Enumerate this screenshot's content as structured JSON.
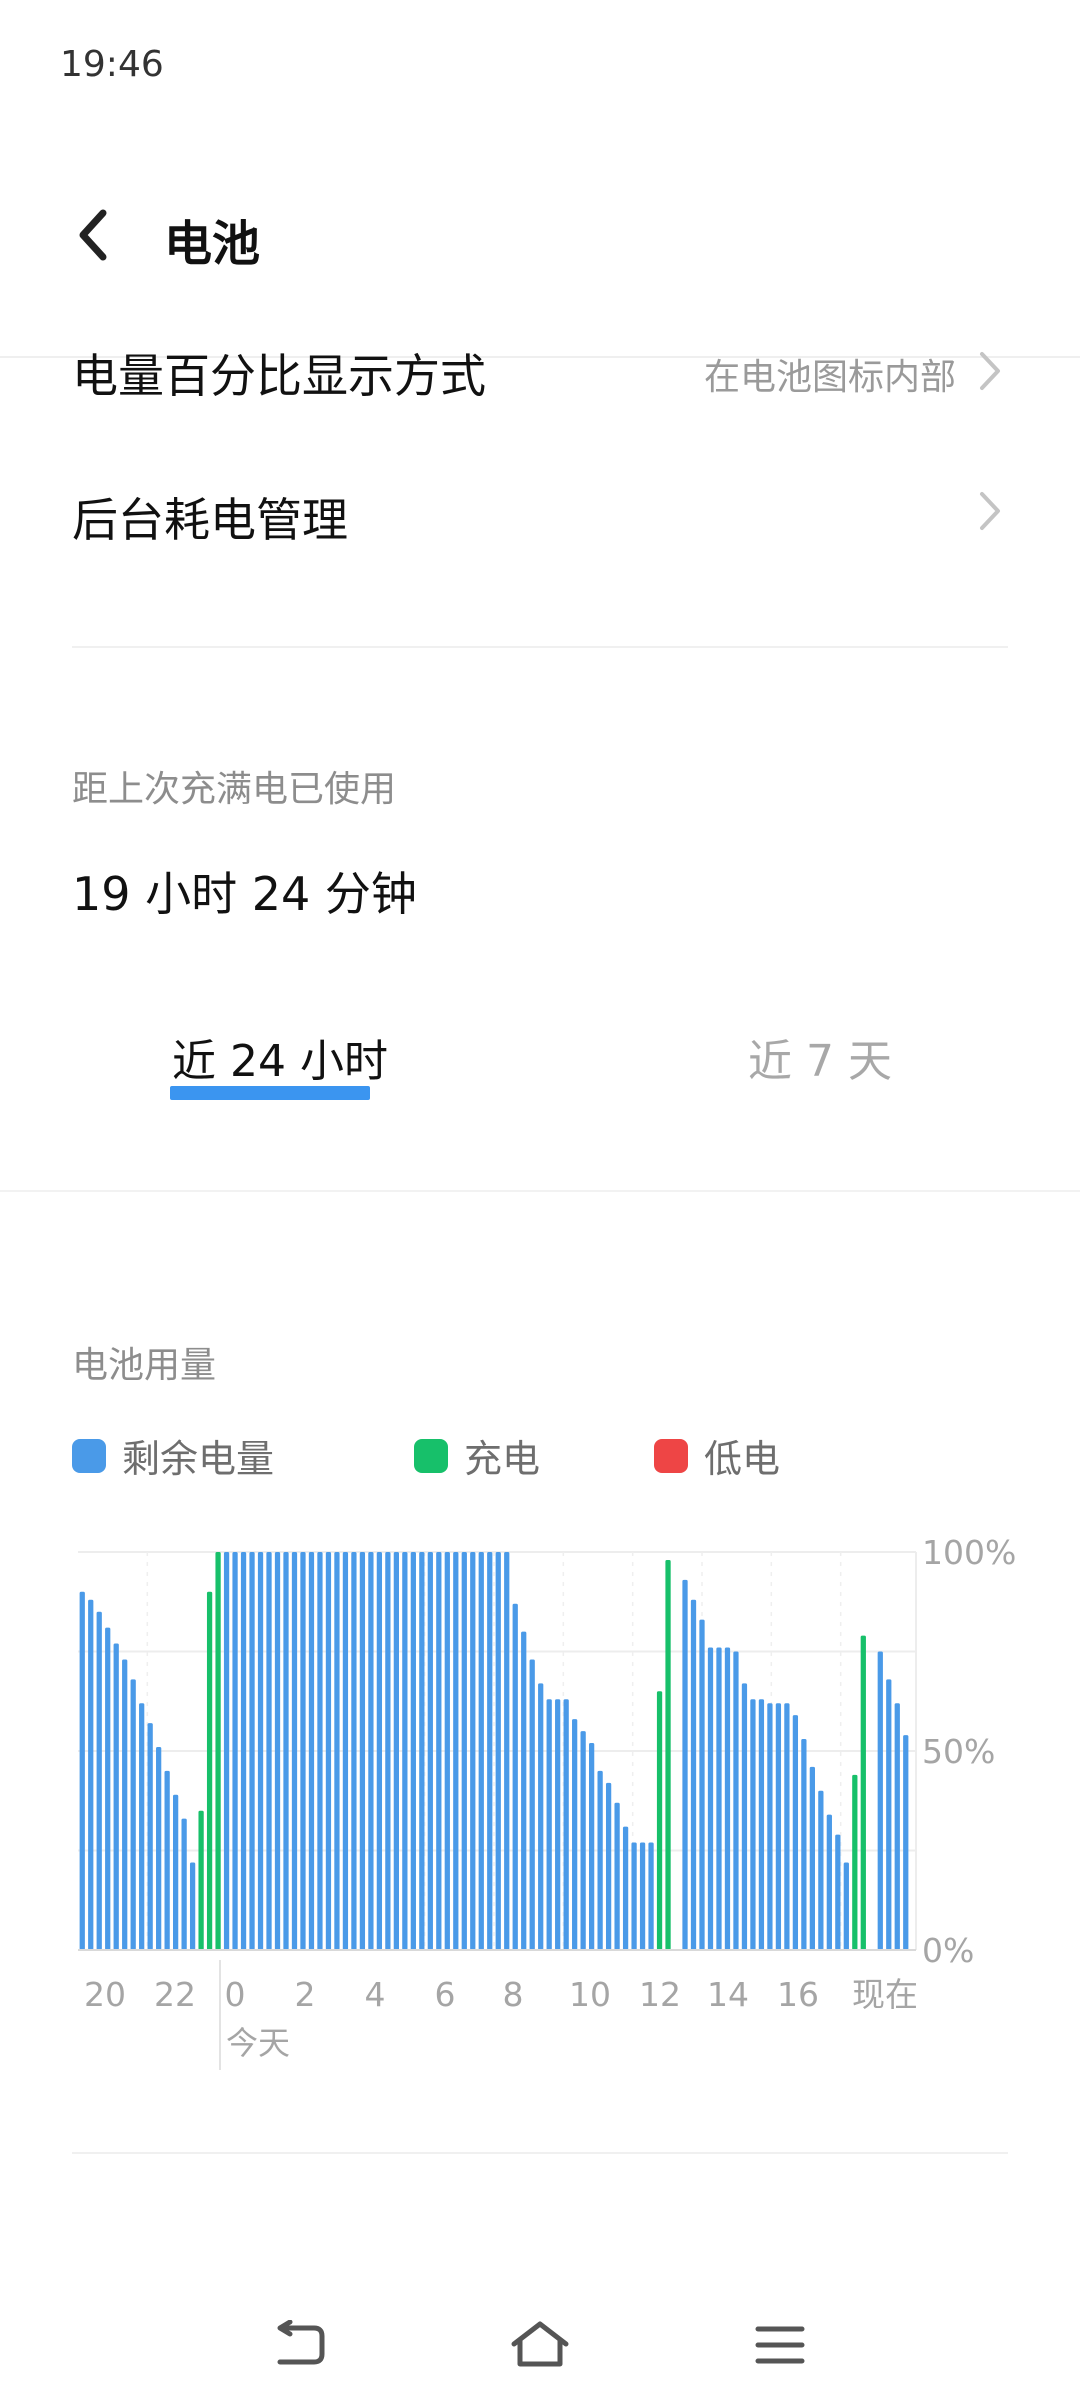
{
  "status": {
    "time": "19:46"
  },
  "header": {
    "title": "电池"
  },
  "settings": {
    "percent_display": {
      "label": "电量百分比显示方式",
      "value": "在电池图标内部"
    },
    "background_power": {
      "label": "后台耗电管理"
    }
  },
  "usage": {
    "since_label": "距上次充满电已使用",
    "since_value": "19 小时 24 分钟"
  },
  "tabs": [
    {
      "label": "近 24 小时",
      "selected": true
    },
    {
      "label": "近 7 天",
      "selected": false
    }
  ],
  "chart_section": {
    "title": "电池用量",
    "legend": [
      {
        "label": "剩余电量",
        "color": "#4a9ae8"
      },
      {
        "label": "充电",
        "color": "#17c06a"
      },
      {
        "label": "低电",
        "color": "#ee4545"
      }
    ]
  },
  "chart_data": {
    "type": "bar",
    "ylim": [
      0,
      100
    ],
    "y_ticks": [
      "100%",
      "50%",
      "0%"
    ],
    "x_ticks": [
      "20",
      "22",
      "0",
      "2",
      "4",
      "6",
      "8",
      "10",
      "12",
      "14",
      "16",
      "现在"
    ],
    "x_sublabel": "今天",
    "grid": true,
    "series": [
      {
        "name": "剩余电量",
        "color": "#4a9ae8",
        "values": [
          90,
          88,
          85,
          81,
          77,
          73,
          68,
          62,
          57,
          51,
          45,
          39,
          33,
          22,
          0,
          0,
          0,
          100,
          100,
          100,
          100,
          100,
          100,
          100,
          100,
          100,
          100,
          100,
          100,
          100,
          100,
          100,
          100,
          100,
          100,
          100,
          100,
          100,
          100,
          100,
          100,
          100,
          100,
          100,
          100,
          100,
          100,
          100,
          100,
          100,
          100,
          87,
          80,
          73,
          67,
          63,
          63,
          63,
          58,
          55,
          52,
          45,
          42,
          37,
          31,
          27,
          27,
          27,
          0,
          0,
          0,
          93,
          88,
          83,
          76,
          76,
          76,
          75,
          67,
          63,
          63,
          62,
          62,
          62,
          59,
          53,
          46,
          40,
          34,
          29,
          22,
          0,
          0,
          0,
          75,
          68,
          62,
          54
        ]
      },
      {
        "name": "充电",
        "color": "#17c06a",
        "values": [
          0,
          0,
          0,
          0,
          0,
          0,
          0,
          0,
          0,
          0,
          0,
          0,
          0,
          0,
          35,
          90,
          100,
          0,
          0,
          0,
          0,
          0,
          0,
          0,
          0,
          0,
          0,
          0,
          0,
          0,
          0,
          0,
          0,
          0,
          0,
          0,
          0,
          0,
          0,
          0,
          0,
          0,
          0,
          0,
          0,
          0,
          0,
          0,
          0,
          0,
          0,
          0,
          0,
          0,
          0,
          0,
          0,
          0,
          0,
          0,
          0,
          0,
          0,
          0,
          0,
          0,
          0,
          0,
          65,
          98,
          0,
          0,
          0,
          0,
          0,
          0,
          0,
          0,
          0,
          0,
          0,
          0,
          0,
          0,
          0,
          0,
          0,
          0,
          0,
          0,
          0,
          44,
          79,
          0,
          0,
          0,
          0
        ]
      }
    ]
  }
}
